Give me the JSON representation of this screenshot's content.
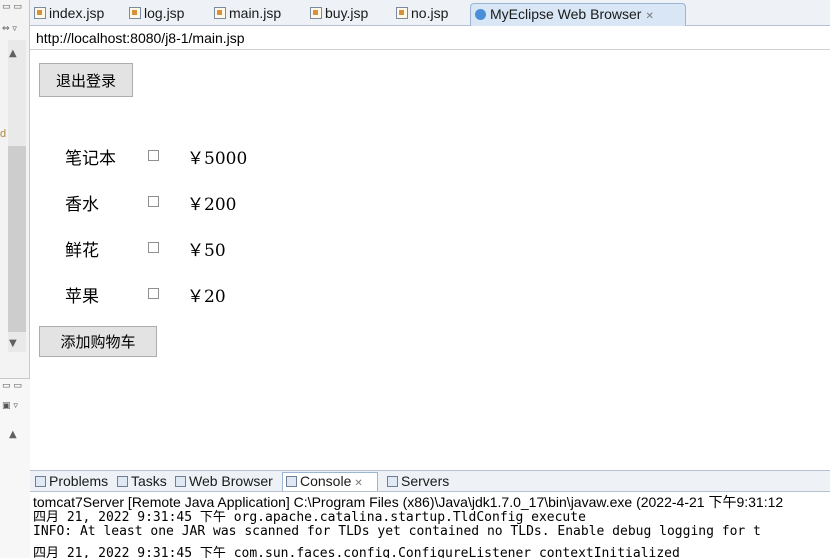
{
  "editor": {
    "tabs": [
      {
        "label": "index.jsp"
      },
      {
        "label": "log.jsp"
      },
      {
        "label": "main.jsp"
      },
      {
        "label": "buy.jsp"
      },
      {
        "label": "no.jsp"
      },
      {
        "label": "MyEclipse Web Browser",
        "active": true
      }
    ]
  },
  "browser": {
    "url": "http://localhost:8080/j8-1/main.jsp"
  },
  "page": {
    "logout_label": "退出登录",
    "products": [
      {
        "name": "笔记本",
        "price": "￥5000"
      },
      {
        "name": "香水",
        "price": "￥200"
      },
      {
        "name": "鲜花",
        "price": "￥50"
      },
      {
        "name": "苹果",
        "price": "￥20"
      }
    ],
    "add_to_cart_label": "添加购物车"
  },
  "bottom_panel": {
    "tabs": [
      {
        "label": "Problems"
      },
      {
        "label": "Tasks"
      },
      {
        "label": "Web Browser"
      },
      {
        "label": "Console",
        "active": true
      },
      {
        "label": "Servers"
      }
    ],
    "console_title": "tomcat7Server [Remote Java Application] C:\\Program Files (x86)\\Java\\jdk1.7.0_17\\bin\\javaw.exe (2022-4-21 下午9:31:12",
    "lines": [
      "四月 21, 2022 9:31:45 下午 org.apache.catalina.startup.TldConfig execute",
      "INFO: At least one JAR was scanned for TLDs yet contained no TLDs. Enable debug logging for t",
      "四月 21, 2022 9:31:45 下午 com.sun.faces.config.ConfigureListener contextInitialized"
    ]
  },
  "left_strip": {
    "fragment_text": "d"
  },
  "colors": {
    "tab_bar_bg": "#eef1f5",
    "active_tab_bg": "#d8e6f5",
    "button_bg": "#e3e3e3"
  }
}
